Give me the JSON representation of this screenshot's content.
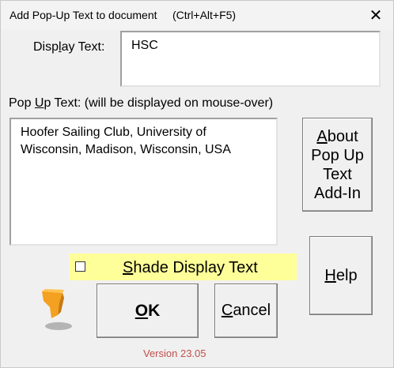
{
  "window": {
    "title": "Add Pop-Up Text to document     (Ctrl+Alt+F5)",
    "close_glyph": "✕"
  },
  "display_text": {
    "label_pre": "Disp",
    "label_ul": "l",
    "label_post": "ay Text:",
    "value": "HSC"
  },
  "popup_text": {
    "label_pre": "Pop ",
    "label_ul": "U",
    "label_post": "p Text: (will be displayed on mouse-over)",
    "value": "Hoofer Sailing Club, University of Wisconsin, Madison, Wisconsin, USA"
  },
  "about_button": {
    "ul": "A",
    "line1_rest": "bout",
    "line2": "Pop Up",
    "line3": "Text",
    "line4": "Add-In"
  },
  "help_button": {
    "ul": "H",
    "rest": "elp"
  },
  "shade_checkbox": {
    "ul": "S",
    "rest": "hade Display Text",
    "checked": false,
    "bg": "#ffff99"
  },
  "ok_button": {
    "ul": "O",
    "rest": "K"
  },
  "cancel_button": {
    "ul": "C",
    "rest": "ancel"
  },
  "version": {
    "text": "Version 23.05",
    "color": "#c0504d"
  },
  "logo": {
    "icon": "popup-text-addin-logo-icon",
    "color": "#f4a020"
  }
}
